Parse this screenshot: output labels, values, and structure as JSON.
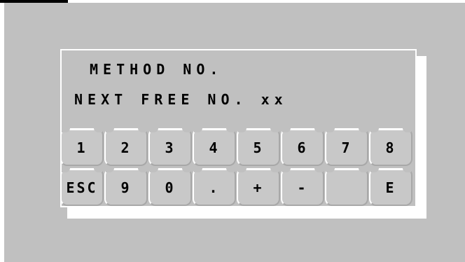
{
  "display": {
    "line1": "METHOD NO.",
    "line2": "NEXT FREE NO. xx"
  },
  "keypad": {
    "row1": [
      "1",
      "2",
      "3",
      "4",
      "5",
      "6",
      "7",
      "8"
    ],
    "row2": [
      "ESC",
      "9",
      "0",
      ".",
      "+",
      "-",
      "",
      "E"
    ]
  }
}
